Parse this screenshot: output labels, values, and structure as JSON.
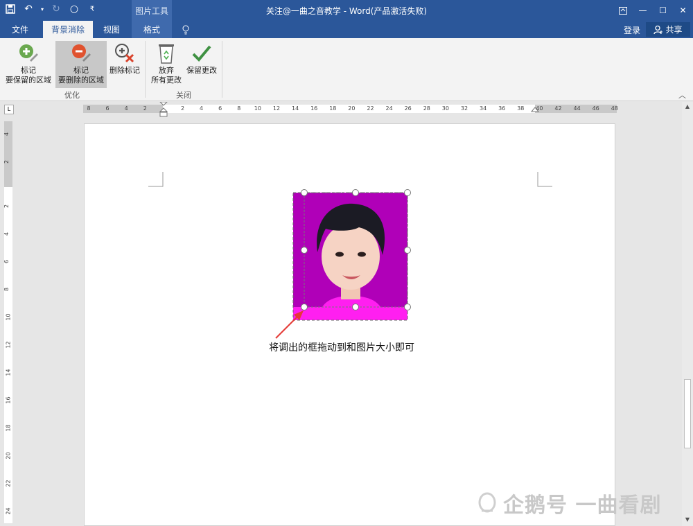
{
  "window": {
    "title": "关注@一曲之音教学 - Word(产品激活失败)",
    "context_tools_label": "图片工具"
  },
  "tabs": {
    "file": "文件",
    "background_removal": "背景消除",
    "view": "视图",
    "format": "格式"
  },
  "account": {
    "login": "登录",
    "share": "共享"
  },
  "ribbon": {
    "mark_keep_line1": "标记",
    "mark_keep_line2": "要保留的区域",
    "mark_remove_line1": "标记",
    "mark_remove_line2": "要删除的区域",
    "delete_mark": "删除标记",
    "discard_line1": "放弃",
    "discard_line2": "所有更改",
    "keep_changes": "保留更改",
    "group_refine": "优化",
    "group_close": "关闭"
  },
  "ruler": {
    "horizontal": [
      "8",
      "6",
      "4",
      "2",
      "2",
      "4",
      "6",
      "8",
      "10",
      "12",
      "14",
      "16",
      "18",
      "20",
      "22",
      "24",
      "26",
      "28",
      "30",
      "32",
      "34",
      "36",
      "38",
      "40",
      "42",
      "44",
      "46",
      "48"
    ],
    "vertical": [
      "4",
      "2",
      "2",
      "4",
      "6",
      "8",
      "10",
      "12",
      "14",
      "16",
      "18",
      "20",
      "22",
      "24"
    ],
    "corner": "L"
  },
  "document": {
    "caption": "将调出的框拖动到和图片大小即可"
  },
  "watermark": "企鹅号 一曲看剧",
  "colors": {
    "title_bar": "#2b579a",
    "photo_background_removed": "#b000b8",
    "photo_background_kept": "#ff1ff0",
    "arrow": "#e53935"
  }
}
